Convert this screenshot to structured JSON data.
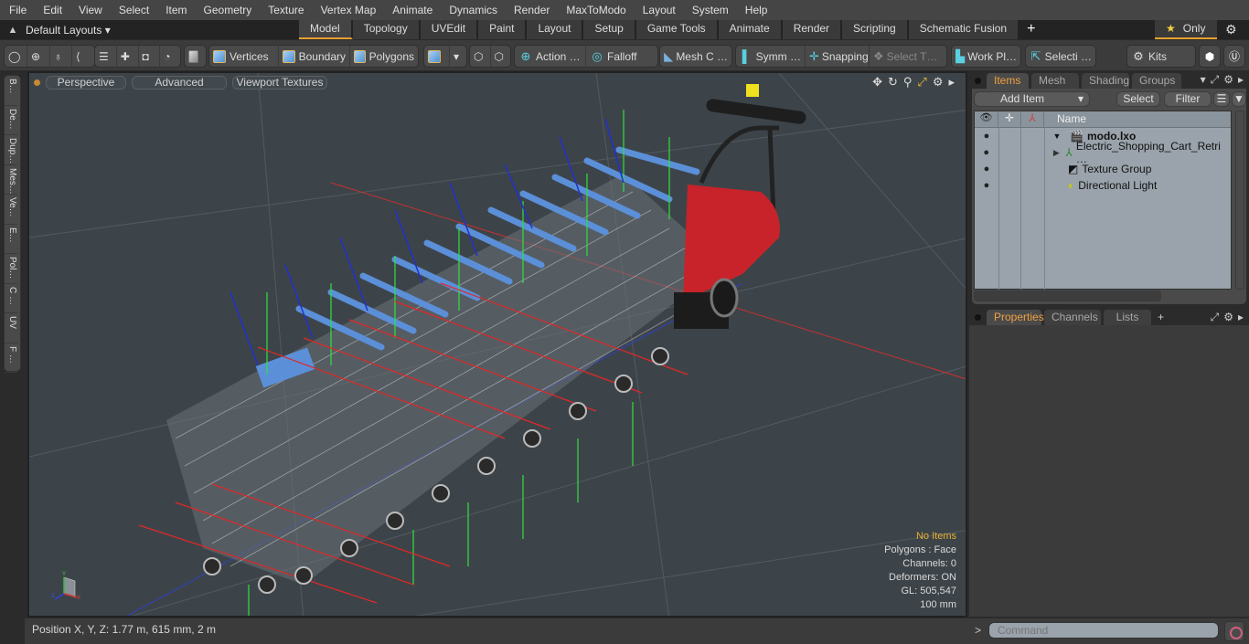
{
  "menubar": {
    "items": [
      "File",
      "Edit",
      "View",
      "Select",
      "Item",
      "Geometry",
      "Texture",
      "Vertex Map",
      "Animate",
      "Dynamics",
      "Render",
      "MaxToModo",
      "Layout",
      "System",
      "Help"
    ]
  },
  "layoutbar": {
    "layout_selector": "Default Layouts ▾",
    "tabs": [
      "Model",
      "Topology",
      "UVEdit",
      "Paint",
      "Layout",
      "Setup",
      "Game Tools",
      "Animate",
      "Render",
      "Scripting",
      "Schematic Fusion"
    ],
    "active_tab": "Model",
    "add_tab": "+",
    "only_label": "Only"
  },
  "toolbar": {
    "vertices": "Vertices",
    "boundary": "Boundary",
    "polygons": "Polygons",
    "action": "Action …",
    "falloff": "Falloff",
    "mesh_constraints": "Mesh C …",
    "symmetry": "Symm …",
    "snapping": "Snapping",
    "select_through": "Select T…",
    "work_plane": "Work Pl…",
    "selection": "Selecti …",
    "kits": "Kits"
  },
  "left_tabs": [
    "B…",
    "De…",
    "Dup…",
    "Mes…",
    "Ve…",
    "E…",
    "Pol…",
    "C …",
    "UV",
    "F …"
  ],
  "viewport": {
    "view_mode": "Perspective",
    "shading": "Advanced",
    "textures": "Viewport Textures",
    "hud": {
      "selection": "No Items",
      "polygons": "Polygons : Face",
      "channels": "Channels: 0",
      "deformers": "Deformers: ON",
      "gl": "GL: 505,547",
      "grid": "100 mm"
    },
    "axis_labels": {
      "y": "Y",
      "x": "X",
      "z": "Z"
    }
  },
  "status": {
    "position": "Position X, Y, Z:   1.77 m, 615 mm, 2 m"
  },
  "items_panel": {
    "tabs": [
      "Items",
      "Mesh …",
      "Shading",
      "Groups"
    ],
    "active_tab": "Items",
    "add_item": "Add Item",
    "select": "Select",
    "filter": "Filter",
    "column_name": "Name",
    "tree": [
      {
        "label": "modo.lxo",
        "bold": true,
        "icon": "scene-icon",
        "expander": "▼"
      },
      {
        "label": "Electric_Shopping_Cart_Retri …",
        "icon": "mesh-locator-icon",
        "expander": "▶"
      },
      {
        "label": "Texture Group",
        "icon": "texture-group-icon",
        "expander": ""
      },
      {
        "label": "Directional Light",
        "icon": "light-icon",
        "expander": ""
      }
    ]
  },
  "properties_panel": {
    "tabs": [
      "Properties",
      "Channels",
      "Lists"
    ],
    "active_tab": "Properties",
    "add_tab": "+"
  },
  "command": {
    "prompt": ">",
    "placeholder": "Command"
  },
  "colors": {
    "accent": "#e8a030",
    "viewport_bg": "#3d4449",
    "cart_handle": "#5b8fd8",
    "tug_body": "#c8232a"
  }
}
